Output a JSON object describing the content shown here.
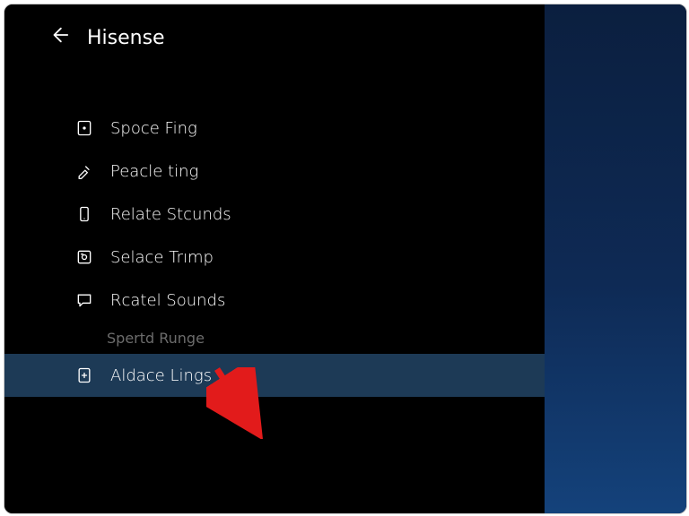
{
  "header": {
    "title": "Hisense"
  },
  "menu": {
    "items": [
      {
        "label": "Spoce Fing"
      },
      {
        "label": "Peacle ting"
      },
      {
        "label": "Relate Stcunds"
      },
      {
        "label": "Selace Trımp"
      },
      {
        "label": "Rcatel Sounds"
      }
    ],
    "sublabel": "Spertd Runge",
    "selected": {
      "label": "Aldace Lings"
    }
  }
}
